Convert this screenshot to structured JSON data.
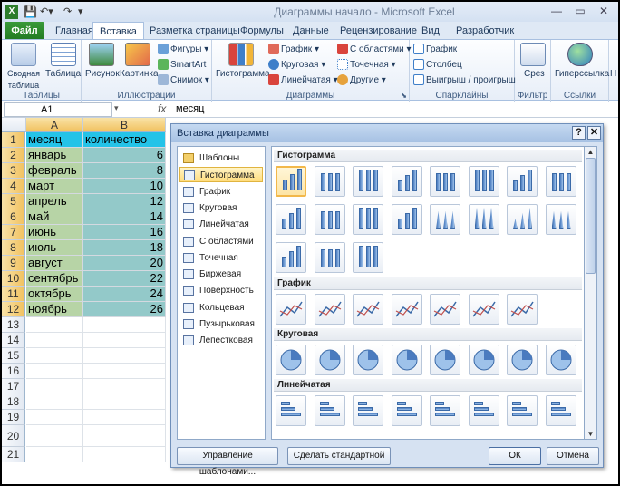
{
  "app": {
    "title": "Диаграммы начало - Microsoft Excel"
  },
  "tabs": [
    "Файл",
    "Главная",
    "Вставка",
    "Разметка страницы",
    "Формулы",
    "Данные",
    "Рецензирование",
    "Вид",
    "Разработчик"
  ],
  "ribbon": {
    "tables": {
      "pivot": "Сводная таблица",
      "table": "Таблица",
      "label": "Таблицы"
    },
    "illustrations": {
      "picture": "Рисунок",
      "clipart": "Картинка",
      "shapes": "Фигуры",
      "smartart": "SmartArt",
      "screenshot": "Снимок",
      "label": "Иллюстрации"
    },
    "charts": {
      "histogram": "Гистограмма",
      "line": "График",
      "pie": "Круговая",
      "bar": "Линейчатая",
      "area": "С областями",
      "scatter": "Точечная",
      "other": "Другие",
      "label": "Диаграммы"
    },
    "sparklines": {
      "line": "График",
      "column": "Столбец",
      "winloss": "Выигрыш / проигрыш",
      "label": "Спарклайны"
    },
    "filter": {
      "slicer": "Срез",
      "label": "Фильтр"
    },
    "links": {
      "hyperlink": "Гиперссылка",
      "label": "Ссылки"
    }
  },
  "formula_bar": {
    "name_box": "A1",
    "fx": "fx",
    "value": "месяц"
  },
  "sheet": {
    "columns": [
      "A",
      "B"
    ],
    "rows": [
      [
        "месяц",
        "количество"
      ],
      [
        "январь",
        "6"
      ],
      [
        "февраль",
        "8"
      ],
      [
        "март",
        "10"
      ],
      [
        "апрель",
        "12"
      ],
      [
        "май",
        "14"
      ],
      [
        "июнь",
        "16"
      ],
      [
        "июль",
        "18"
      ],
      [
        "август",
        "20"
      ],
      [
        "сентябрь",
        "22"
      ],
      [
        "октябрь",
        "24"
      ],
      [
        "ноябрь",
        "26"
      ]
    ],
    "row_numbers": [
      "1",
      "2",
      "3",
      "4",
      "5",
      "6",
      "7",
      "8",
      "9",
      "10",
      "11",
      "12",
      "13",
      "14",
      "15",
      "16",
      "17",
      "18",
      "19",
      "20",
      "21"
    ]
  },
  "dialog": {
    "title": "Вставка диаграммы",
    "help": "?",
    "close": "✕",
    "categories": [
      "Шаблоны",
      "Гистограмма",
      "График",
      "Круговая",
      "Линейчатая",
      "С областями",
      "Точечная",
      "Биржевая",
      "Поверхность",
      "Кольцевая",
      "Пузырьковая",
      "Лепестковая"
    ],
    "selected_category": "Гистограмма",
    "sections": [
      "Гистограмма",
      "График",
      "Круговая",
      "Линейчатая"
    ],
    "buttons": {
      "manage": "Управление шаблонами...",
      "default": "Сделать стандартной",
      "ok": "ОК",
      "cancel": "Отмена"
    }
  }
}
